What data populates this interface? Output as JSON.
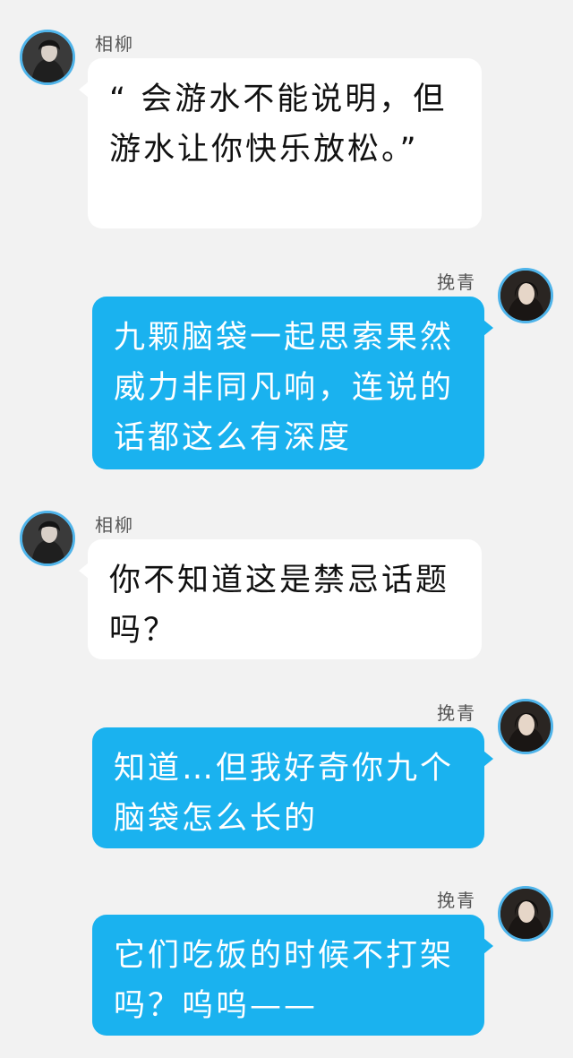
{
  "messages": [
    {
      "side": "left",
      "sender": "相柳",
      "avatar": "avatar-xiangliu",
      "text": "“ 会游水不能说明，但游水让你快乐放松。”"
    },
    {
      "side": "right",
      "sender": "挽青",
      "avatar": "avatar-wanqing",
      "text": "九颗脑袋一起思索果然威力非同凡响，连说的话都这么有深度"
    },
    {
      "side": "left",
      "sender": "相柳",
      "avatar": "avatar-xiangliu",
      "text": "你不知道这是禁忌话题吗？"
    },
    {
      "side": "right",
      "sender": "挽青",
      "avatar": "avatar-wanqing",
      "text": "知道…但我好奇你九个脑袋怎么长的"
    },
    {
      "side": "right",
      "sender": "挽青",
      "avatar": "avatar-wanqing",
      "text": "它们吃饭的时候不打架吗？呜呜——"
    }
  ],
  "colors": {
    "background": "#f2f2f2",
    "incoming_bubble": "#ffffff",
    "outgoing_bubble": "#1ab2ef",
    "avatar_ring": "#4fb4ea"
  }
}
